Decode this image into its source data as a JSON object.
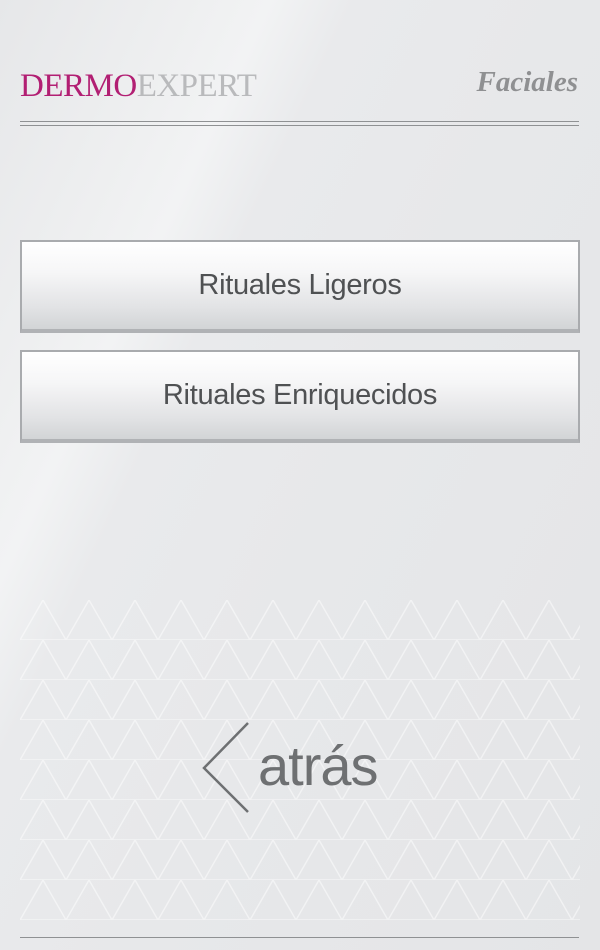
{
  "header": {
    "brand_part1": "DERMO",
    "brand_part2": "EXPERT",
    "section_title": "Faciales"
  },
  "menu": {
    "items": [
      {
        "label": "Rituales Ligeros"
      },
      {
        "label": "Rituales Enriquecidos"
      }
    ]
  },
  "nav": {
    "back_label": "atrás",
    "back_icon": "chevron-left-icon"
  },
  "colors": {
    "brand_accent": "#b21f73",
    "brand_secondary": "#b9babc",
    "title_gray": "#8f9092",
    "button_text": "#4f5153"
  }
}
